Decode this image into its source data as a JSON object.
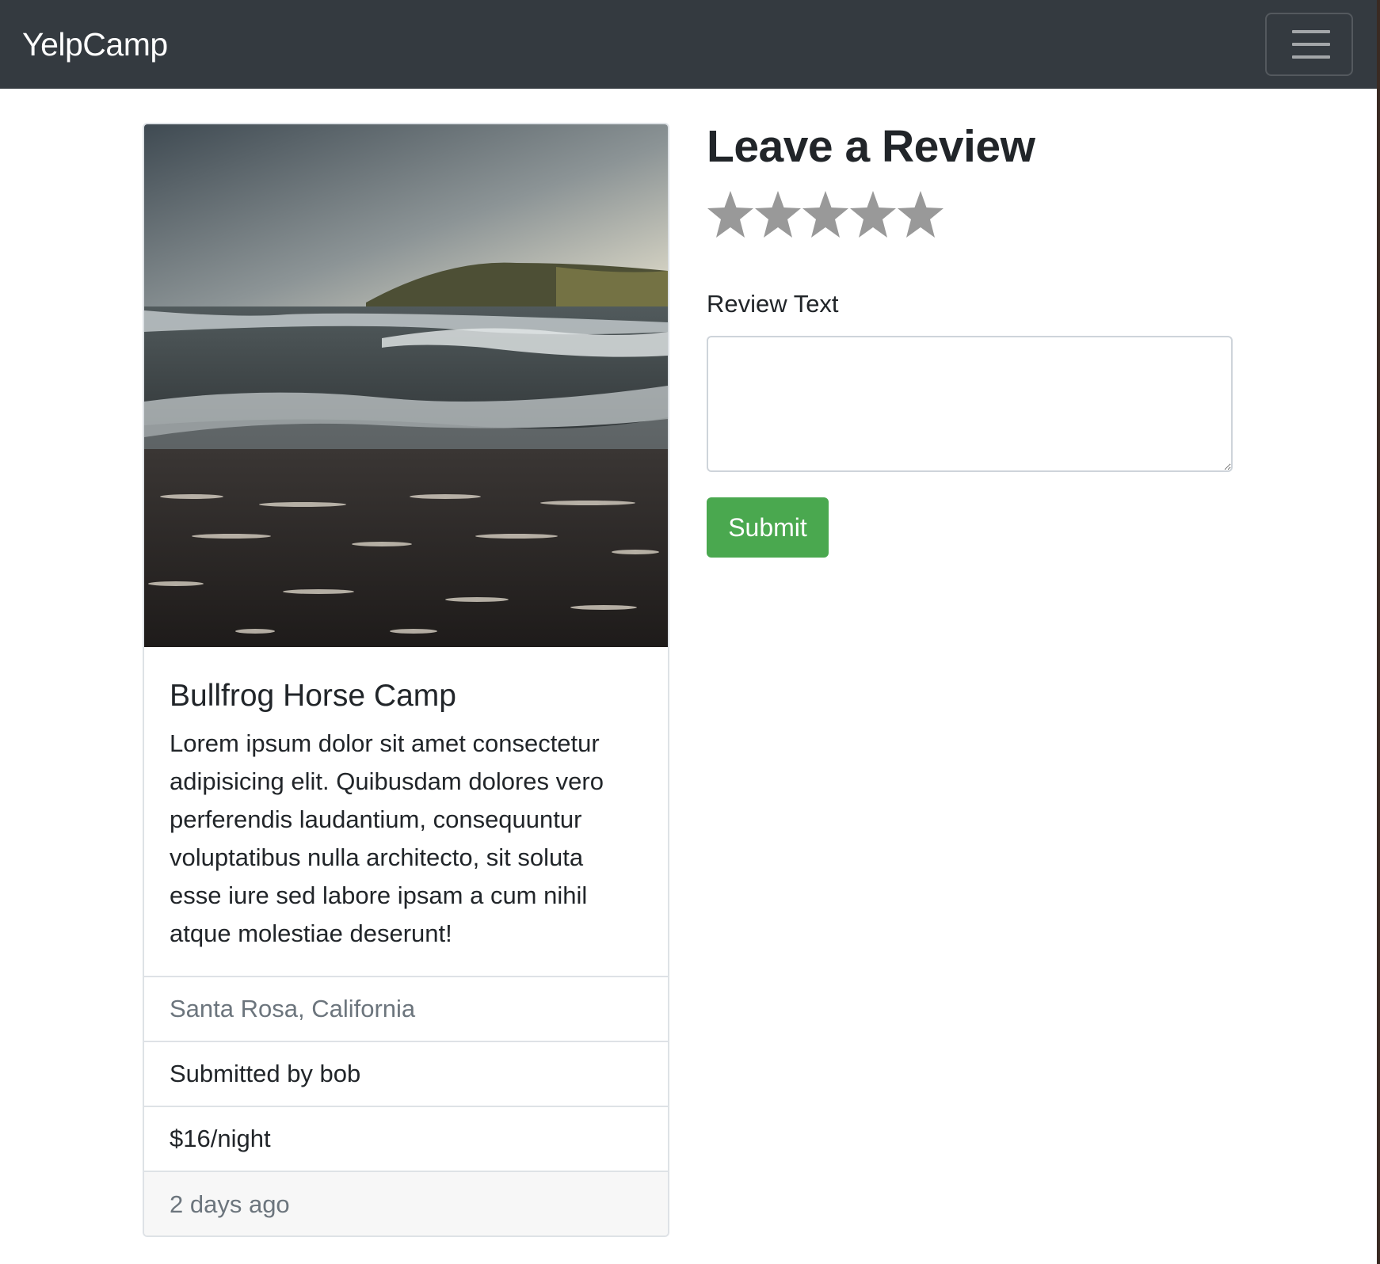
{
  "navbar": {
    "brand": "YelpCamp",
    "menu_icon": "hamburger-icon"
  },
  "campground": {
    "image_alt": "beach-waves-photo",
    "title": "Bullfrog Horse Camp",
    "description": "Lorem ipsum dolor sit amet consectetur adipisicing elit. Quibusdam dolores vero perferendis laudantium, consequuntur voluptatibus nulla architecto, sit soluta esse iure sed labore ipsam a cum nihil atque molestiae deserunt!",
    "location": "Santa Rosa, California",
    "submitted_by": "Submitted by bob",
    "price": "$16/night",
    "posted": "2 days ago"
  },
  "review_form": {
    "heading": "Leave a Review",
    "rating": {
      "value": 0,
      "max": 5,
      "icon": "star-icon"
    },
    "text_label": "Review Text",
    "text_value": "",
    "submit_label": "Submit"
  },
  "colors": {
    "navbar_bg": "#343a40",
    "submit_bg": "#4aa84f",
    "star_color": "#999999",
    "muted_text": "#6c757d"
  }
}
